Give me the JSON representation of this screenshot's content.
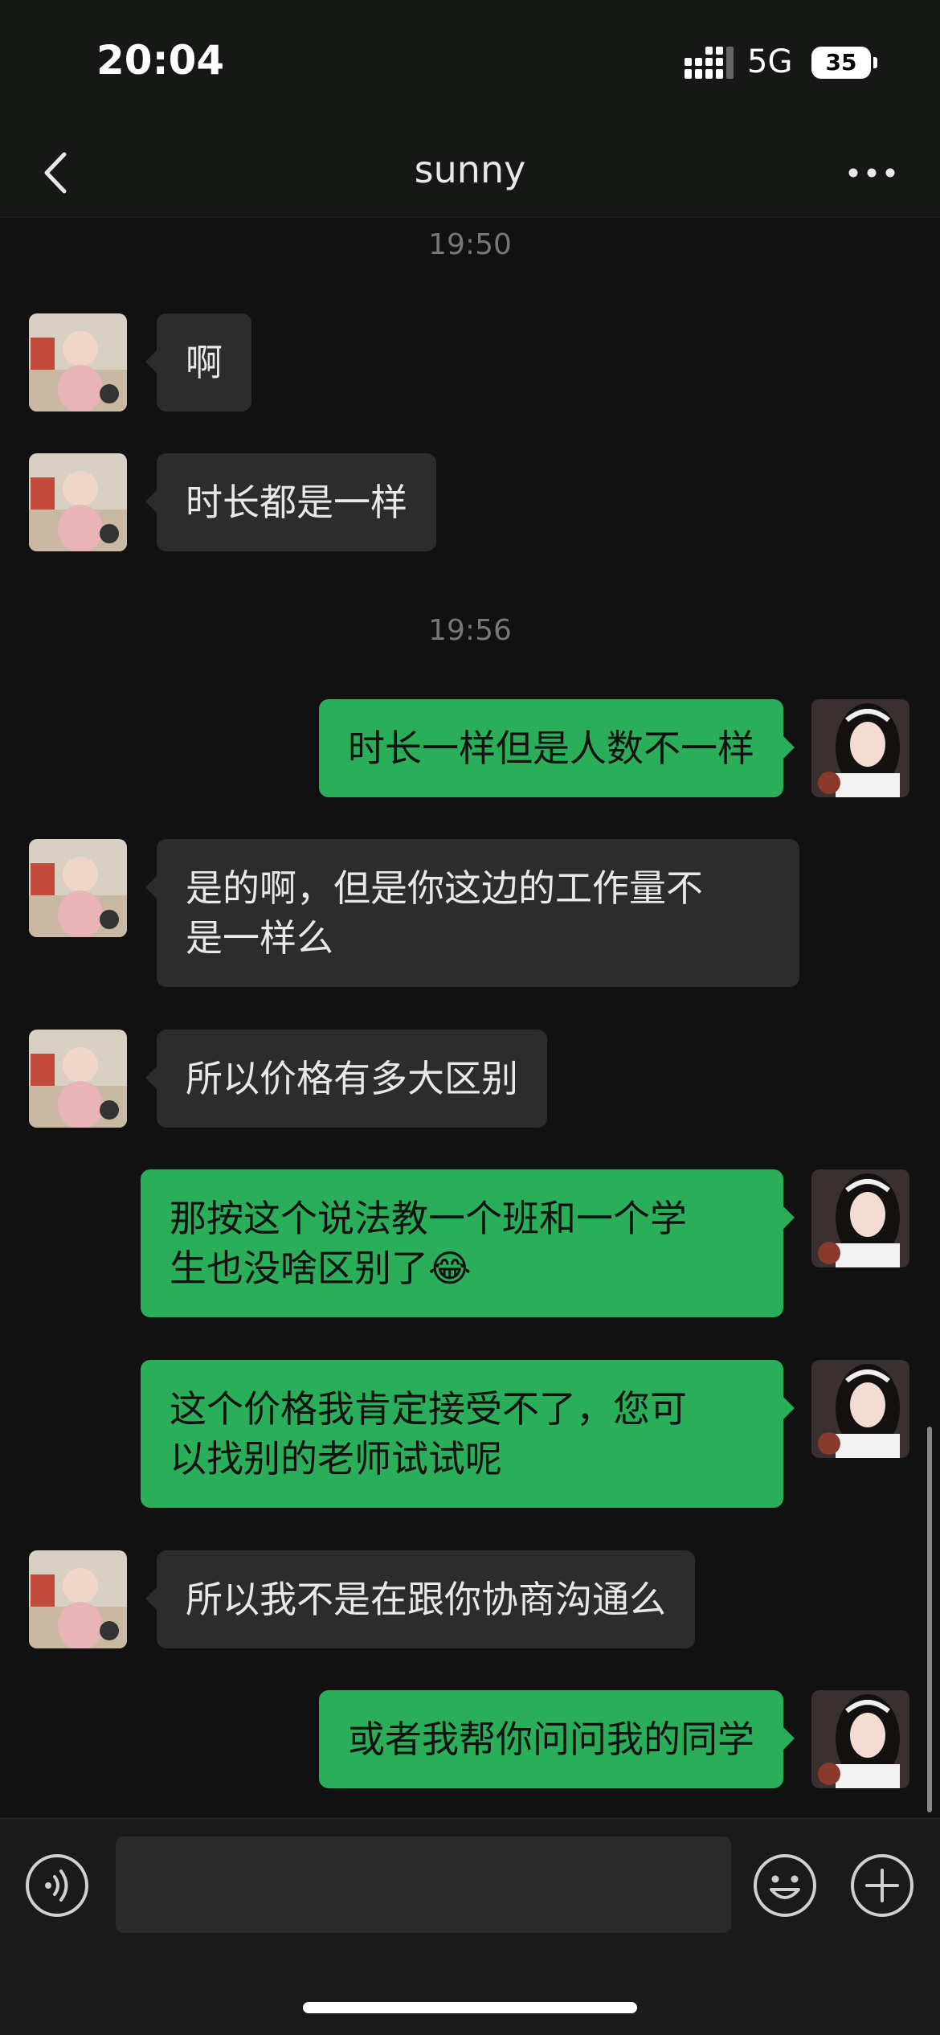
{
  "status_bar": {
    "time": "20:04",
    "network": "5G",
    "battery": "35"
  },
  "header": {
    "title": "sunny"
  },
  "messages": [
    {
      "type": "time",
      "text": "19:50"
    },
    {
      "type": "message",
      "sender": "other",
      "text": "啊"
    },
    {
      "type": "message",
      "sender": "other",
      "text": "时长都是一样"
    },
    {
      "type": "time",
      "text": "19:56"
    },
    {
      "type": "message",
      "sender": "self",
      "text": "时长一样但是人数不一样"
    },
    {
      "type": "message",
      "sender": "other",
      "lines": [
        "是的啊，但是你这边的工作量不",
        "是一样么"
      ]
    },
    {
      "type": "message",
      "sender": "other",
      "text": "所以价格有多大区别"
    },
    {
      "type": "message",
      "sender": "self",
      "lines": [
        "那按这个说法教一个班和一个学",
        "生也没啥区别了😂"
      ]
    },
    {
      "type": "message",
      "sender": "self",
      "lines": [
        "这个价格我肯定接受不了，您可",
        "以找别的老师试试呢"
      ]
    },
    {
      "type": "message",
      "sender": "other",
      "text": "所以我不是在跟你协商沟通么"
    },
    {
      "type": "message",
      "sender": "self",
      "text": "或者我帮你问问我的同学"
    }
  ],
  "input": {
    "value": ""
  },
  "colors": {
    "background": "#111111",
    "self_bubble": "#2aae5a",
    "other_bubble": "#2c2c2c",
    "timestamp": "#777777"
  },
  "icons": {
    "back": "chevron-left-icon",
    "more": "more-dots-icon",
    "voice": "voice-icon",
    "emoji": "emoji-icon",
    "plus": "plus-icon"
  }
}
